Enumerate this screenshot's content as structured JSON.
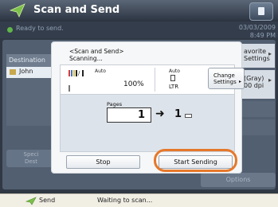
{
  "header": {
    "title": "Scan and Send"
  },
  "status": {
    "ready_text": "Ready to send.",
    "date": "03/03/2009",
    "time": "8:49 PM"
  },
  "background": {
    "destination_header": "Destination",
    "destination_item": "John",
    "favorite_settings": [
      "avorite",
      "Settings"
    ],
    "setting_summary": [
      "(Gray)",
      "00 dpi"
    ],
    "special_button": [
      "Speci",
      "Dest"
    ],
    "options_label": "Options"
  },
  "dialog": {
    "title_line1": "<Scan and Send>",
    "title_line2": "Scanning...",
    "color_mode_auto": "Auto",
    "zoom": "100%",
    "paper_auto": "Auto",
    "paper_size": "LTR",
    "change_settings": [
      "Change",
      "Settings"
    ],
    "pages_label": "Pages",
    "pages_scanned": "1",
    "pages_sent": "1",
    "stop_label": "Stop",
    "start_label": "Start Sending"
  },
  "footer": {
    "send_label": "Send",
    "message": "Waiting to scan..."
  },
  "colors": {
    "highlight": "#e6782a",
    "ready_dot": "#5fb64a",
    "icon_green": "#7cc14a"
  },
  "icons": [
    "send-icon",
    "color-mode-icon",
    "page-icon",
    "tray-icon",
    "arrow-right-icon"
  ]
}
